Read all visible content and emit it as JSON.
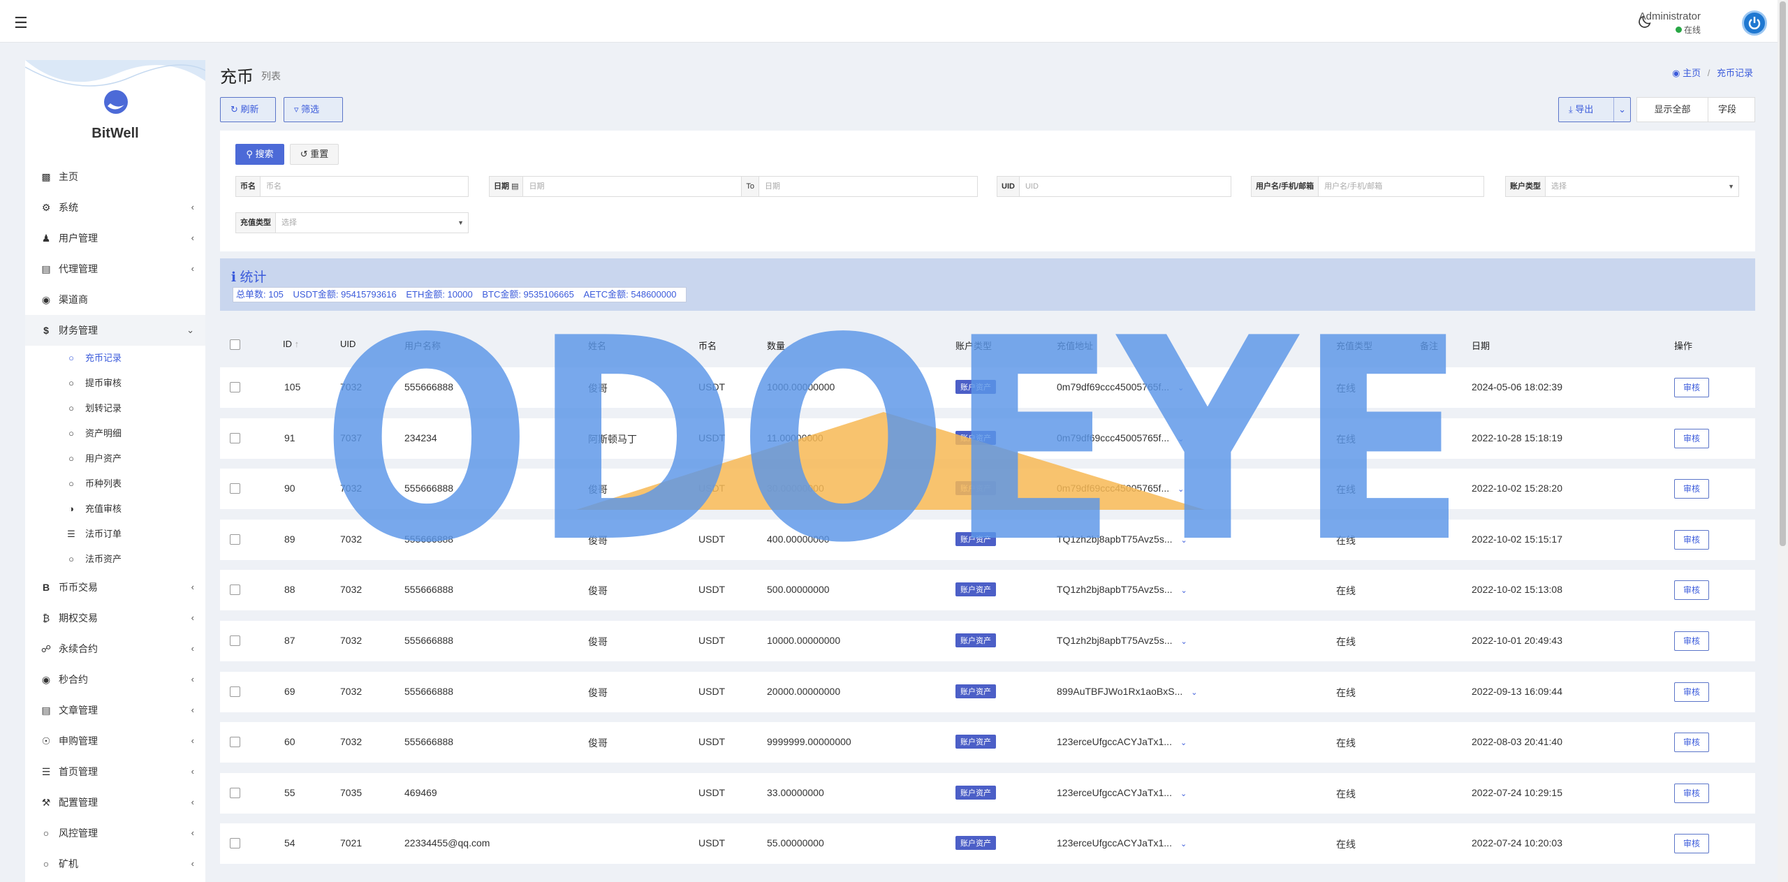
{
  "topbar": {
    "admin_name": "Administrator",
    "admin_status": "在线"
  },
  "brand": {
    "name": "BitWell"
  },
  "nav": {
    "items": [
      {
        "label": "主页",
        "icon": "chart-icon",
        "has_children": false
      },
      {
        "label": "系统",
        "icon": "gear-icon",
        "has_children": true
      },
      {
        "label": "用户管理",
        "icon": "user-tie-icon",
        "has_children": true
      },
      {
        "label": "代理管理",
        "icon": "id-card-icon",
        "has_children": true
      },
      {
        "label": "渠道商",
        "icon": "user-circle-icon",
        "has_children": false
      },
      {
        "label": "财务管理",
        "icon": "dollar-icon",
        "has_children": true,
        "open": true
      }
    ],
    "finance_sub": [
      {
        "label": "充币记录",
        "icon": "circle-icon",
        "active": true
      },
      {
        "label": "提币审核",
        "icon": "circle-icon"
      },
      {
        "label": "划转记录",
        "icon": "circle-icon"
      },
      {
        "label": "资产明细",
        "icon": "circle-icon"
      },
      {
        "label": "用户资产",
        "icon": "circle-icon"
      },
      {
        "label": "币种列表",
        "icon": "circle-icon"
      },
      {
        "label": "充值审核",
        "icon": "half-circle-icon"
      },
      {
        "label": "法币订单",
        "icon": "list-icon"
      },
      {
        "label": "法币资产",
        "icon": "circle-icon"
      }
    ],
    "items_after": [
      {
        "label": "币币交易",
        "icon": "bitcoin-b-icon"
      },
      {
        "label": "期权交易",
        "icon": "bitcoin-icon"
      },
      {
        "label": "永续合约",
        "icon": "link-icon"
      },
      {
        "label": "秒合约",
        "icon": "dot-circle-icon"
      },
      {
        "label": "文章管理",
        "icon": "newspaper-icon"
      },
      {
        "label": "申购管理",
        "icon": "life-ring-icon"
      },
      {
        "label": "首页管理",
        "icon": "list-icon"
      },
      {
        "label": "配置管理",
        "icon": "wrench-icon"
      },
      {
        "label": "风控管理",
        "icon": "circle-icon"
      },
      {
        "label": "矿机",
        "icon": "circle-icon"
      }
    ]
  },
  "page": {
    "title": "充币",
    "subtitle": "列表",
    "breadcrumb_home": "主页",
    "breadcrumb_current": "充币记录"
  },
  "toolbar": {
    "refresh": "刷新",
    "filter": "筛选",
    "export": "导出",
    "show_all": "显示全部",
    "fields": "字段"
  },
  "filters": {
    "search": "搜索",
    "reset": "重置",
    "coin_label": "币名",
    "coin_placeholder": "币名",
    "date_label": "日期",
    "date_placeholder": "日期",
    "to_label": "To",
    "date_to_placeholder": "日期",
    "uid_label": "UID",
    "uid_placeholder": "UID",
    "user_label": "用户名/手机/邮箱",
    "user_placeholder": "用户名/手机/邮箱",
    "account_type_label": "账户类型",
    "account_type_placeholder": "选择",
    "recharge_type_label": "充值类型",
    "recharge_type_placeholder": "选择"
  },
  "stats": {
    "title": "统计",
    "items": [
      "总单数:  105",
      "USDT金额:  95415793616",
      "ETH金额:  10000",
      "BTC金额:  9535106665",
      "AETC金额:  548600000"
    ]
  },
  "table": {
    "headers": {
      "id": "ID",
      "uid": "UID",
      "username": "用户名称",
      "name": "姓名",
      "coin": "币名",
      "amount": "数量",
      "account_type": "账户类型",
      "address": "充值地址",
      "recharge_type": "充值类型",
      "remark": "备注",
      "date": "日期",
      "action": "操作"
    },
    "rows": [
      {
        "id": "105",
        "uid": "7032",
        "username": "555666888",
        "name": "俊哥",
        "coin": "USDT",
        "amount": "1000.00000000",
        "account_type": "账户资产",
        "address": "0m79df69ccc45005765f...",
        "recharge_type": "在线",
        "date": "2024-05-06 18:02:39",
        "action": "审核"
      },
      {
        "id": "91",
        "uid": "7037",
        "username": "234234",
        "name": "阿斯顿马丁",
        "coin": "USDT",
        "amount": "11.00000000",
        "account_type": "账户资产",
        "address": "0m79df69ccc45005765f...",
        "recharge_type": "在线",
        "date": "2022-10-28 15:18:19",
        "action": "审核"
      },
      {
        "id": "90",
        "uid": "7032",
        "username": "555666888",
        "name": "俊哥",
        "coin": "USDT",
        "amount": "30.00000000",
        "account_type": "账户资产",
        "address": "0m79df69ccc45005765f...",
        "recharge_type": "在线",
        "date": "2022-10-02 15:28:20",
        "action": "审核"
      },
      {
        "id": "89",
        "uid": "7032",
        "username": "555666888",
        "name": "俊哥",
        "coin": "USDT",
        "amount": "400.00000000",
        "account_type": "账户资产",
        "address": "TQ1zh2bj8apbT75Avz5s...",
        "recharge_type": "在线",
        "date": "2022-10-02 15:15:17",
        "action": "审核"
      },
      {
        "id": "88",
        "uid": "7032",
        "username": "555666888",
        "name": "俊哥",
        "coin": "USDT",
        "amount": "500.00000000",
        "account_type": "账户资产",
        "address": "TQ1zh2bj8apbT75Avz5s...",
        "recharge_type": "在线",
        "date": "2022-10-02 15:13:08",
        "action": "审核"
      },
      {
        "id": "87",
        "uid": "7032",
        "username": "555666888",
        "name": "俊哥",
        "coin": "USDT",
        "amount": "10000.00000000",
        "account_type": "账户资产",
        "address": "TQ1zh2bj8apbT75Avz5s...",
        "recharge_type": "在线",
        "date": "2022-10-01 20:49:43",
        "action": "审核"
      },
      {
        "id": "69",
        "uid": "7032",
        "username": "555666888",
        "name": "俊哥",
        "coin": "USDT",
        "amount": "20000.00000000",
        "account_type": "账户资产",
        "address": "899AuTBFJWo1Rx1aoBxS...",
        "recharge_type": "在线",
        "date": "2022-09-13 16:09:44",
        "action": "审核"
      },
      {
        "id": "60",
        "uid": "7032",
        "username": "555666888",
        "name": "俊哥",
        "coin": "USDT",
        "amount": "9999999.00000000",
        "account_type": "账户资产",
        "address": "123erceUfgccACYJaTx1...",
        "recharge_type": "在线",
        "date": "2022-08-03 20:41:40",
        "action": "审核"
      },
      {
        "id": "55",
        "uid": "7035",
        "username": "469469",
        "name": "",
        "coin": "USDT",
        "amount": "33.00000000",
        "account_type": "账户资产",
        "address": "123erceUfgccACYJaTx1...",
        "recharge_type": "在线",
        "date": "2022-07-24 10:29:15",
        "action": "审核"
      },
      {
        "id": "54",
        "uid": "7021",
        "username": "22334455@qq.com",
        "name": "",
        "coin": "USDT",
        "amount": "55.00000000",
        "account_type": "账户资产",
        "address": "123erceUfgccACYJaTx1...",
        "recharge_type": "在线",
        "date": "2022-07-24 10:20:03",
        "action": "审核"
      }
    ]
  },
  "watermark": {
    "text": "ODOEYE"
  },
  "colors": {
    "accent": "#3b5bdb",
    "badge": "#4c5fc7",
    "stats_bg": "#c9d6ee",
    "watermark_blue": "#5b96e8",
    "watermark_orange": "#f7b955",
    "online": "#28a745"
  }
}
